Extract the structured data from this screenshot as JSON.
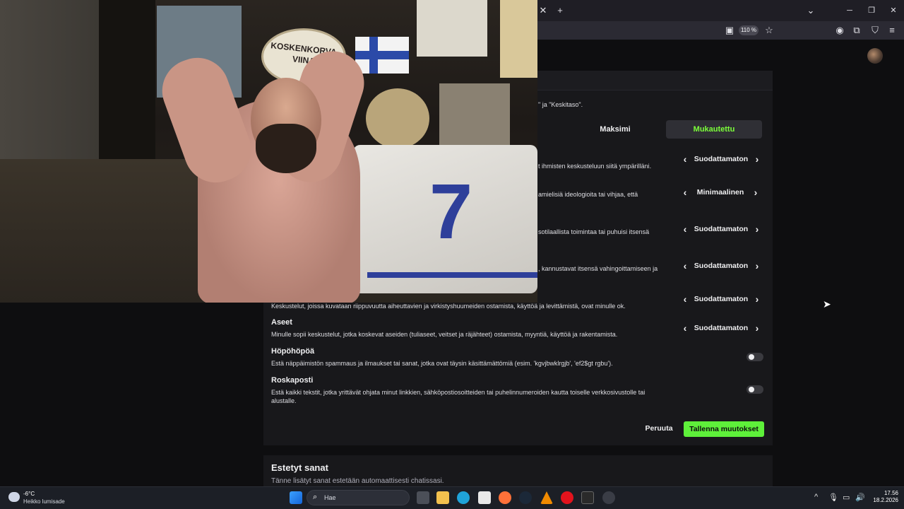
{
  "browser": {
    "zoom": "110 %",
    "new_tab_glyph": "+",
    "close_tab_glyph": "✕"
  },
  "settings": {
    "intro_suffix": "\" ja \"Keskitaso\".",
    "modes": {
      "max": "Maksimi",
      "custom": "Mukautettu"
    },
    "rows": [
      {
        "title": "",
        "desc": "t ihmisten keskusteluun siitä ympärilläni.",
        "value": "Suodattamaton"
      },
      {
        "title": "",
        "desc": "amielisiä ideologioita tai vihjaa, että",
        "value": "Minimaalinen"
      },
      {
        "title": "",
        "desc": "sotilaallista toimintaa tai puhuisi itsensä",
        "value": "Suodattamaton"
      },
      {
        "title": "",
        "desc": ", kannustavat itsensä vahingoittamiseen ja",
        "value": "Suodattamaton"
      },
      {
        "title": "",
        "desc": "Keskustelut, joissa kuvataan riippuvuutta aiheuttavien ja virkistyshuumeiden ostamista, käyttöä ja levittämistä, ovat minulle ok.",
        "value": "Suodattamaton"
      },
      {
        "title": "Aseet",
        "desc": "Minulle sopii keskustelut, jotka koskevat aseiden (tuliaseet, veitset ja räjähteet) ostamista, myyntiä, käyttöä ja rakentamista.",
        "value": "Suodattamaton"
      }
    ],
    "toggles": [
      {
        "title": "Höpöhöpöä",
        "desc": "Estä näppäimistön spammaus ja ilmaukset tai sanat, jotka ovat täysin käsittämättömiä (esim. 'kgvjbwklrgjb', 'ef2$gt rgbu').",
        "on": false
      },
      {
        "title": "Roskaposti",
        "desc": "Estä kaikki tekstit, jotka yrittävät ohjata minut linkkien, sähköpostiosoitteiden tai puhelinnumeroiden kautta toiselle verkkosivustolle tai alustalle.",
        "desc2": "",
        "on": false
      }
    ],
    "cancel": "Peruuta",
    "save": "Tallenna muutokset"
  },
  "blocked_words": {
    "title": "Estetyt sanat",
    "desc": "Tänne lisätyt sanat estetään automaattisesti chatissasi."
  },
  "webcam": {
    "sign_line1": "KOSKENKORVA",
    "sign_line2": "VIINA",
    "jersey_number": "7"
  },
  "taskbar": {
    "temperature": "-6°C",
    "weather": "Heikko lumisade",
    "search_placeholder": "Hae",
    "time": "17.56",
    "date": "18.2.2026"
  },
  "colors": {
    "accent_green": "#5ef03a",
    "panel_bg": "#18181b",
    "page_bg": "#0e0e10"
  }
}
